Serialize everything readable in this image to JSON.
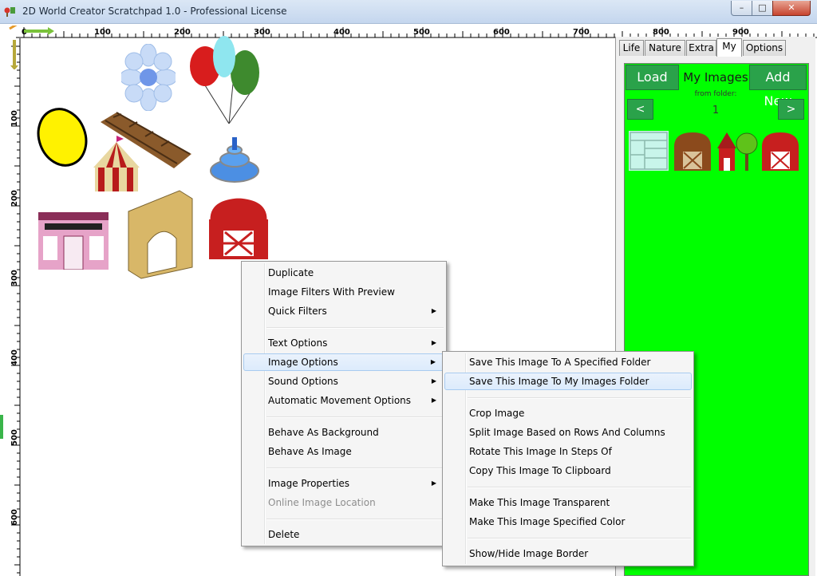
{
  "window": {
    "title": "2D World Creator Scratchpad 1.0 - Professional License",
    "minimize": "–",
    "maximize": "□",
    "close": "✕"
  },
  "ruler": {
    "h_labels": [
      "0",
      "100",
      "200",
      "300",
      "400",
      "500",
      "600",
      "700",
      "800",
      "900"
    ],
    "v_labels": [
      "100",
      "200",
      "300",
      "400",
      "500",
      "600"
    ]
  },
  "canvas_items": [
    "flower-image",
    "balloons-image",
    "lemon-image",
    "bridge-image",
    "fountain-image",
    "circus-tent-image",
    "storefront-image",
    "arch-image",
    "barn-image"
  ],
  "panel": {
    "tabs": [
      "Life",
      "Nature",
      "Extra",
      "My",
      "Options"
    ],
    "active_tab": "My",
    "load_label": "Load",
    "title": "My Images",
    "add_new_label": "Add New",
    "from_folder_label": "from folder:",
    "folder_number": "1",
    "prev_label": "<",
    "next_label": ">",
    "thumbnails": [
      "layout-thumbnail",
      "brown-barn-thumbnail",
      "house-trees-thumbnail",
      "red-barn-thumbnail"
    ],
    "background_color": "#00ff00"
  },
  "context_menu": {
    "items": [
      {
        "label": "Duplicate"
      },
      {
        "label": "Image Filters With Preview"
      },
      {
        "label": "Quick Filters",
        "submenu": true
      },
      {
        "label": "Text Options",
        "submenu": true
      },
      {
        "label": "Image Options",
        "submenu": true,
        "highlighted": true
      },
      {
        "label": "Sound Options",
        "submenu": true
      },
      {
        "label": "Automatic Movement Options",
        "submenu": true
      },
      {
        "label": "Behave As Background"
      },
      {
        "label": "Behave As Image"
      },
      {
        "label": "Image Properties",
        "submenu": true
      },
      {
        "label": "Online Image Location",
        "disabled": true
      },
      {
        "label": "Delete"
      }
    ]
  },
  "submenu": {
    "items": [
      {
        "label": "Save This Image To A Specified Folder"
      },
      {
        "label": "Save This Image To My Images Folder",
        "highlighted": true
      },
      {
        "label": "Crop Image"
      },
      {
        "label": "Split Image Based on Rows And Columns"
      },
      {
        "label": "Rotate This Image In Steps Of"
      },
      {
        "label": "Copy This Image To Clipboard"
      },
      {
        "label": "Make This Image Transparent"
      },
      {
        "label": "Make This Image Specified Color"
      },
      {
        "label": "Show/Hide Image Border"
      }
    ]
  },
  "colors": {
    "accent_green": "#2aa24a",
    "panel_green": "#00ff00",
    "menu_highlight": "#dcebfc"
  }
}
